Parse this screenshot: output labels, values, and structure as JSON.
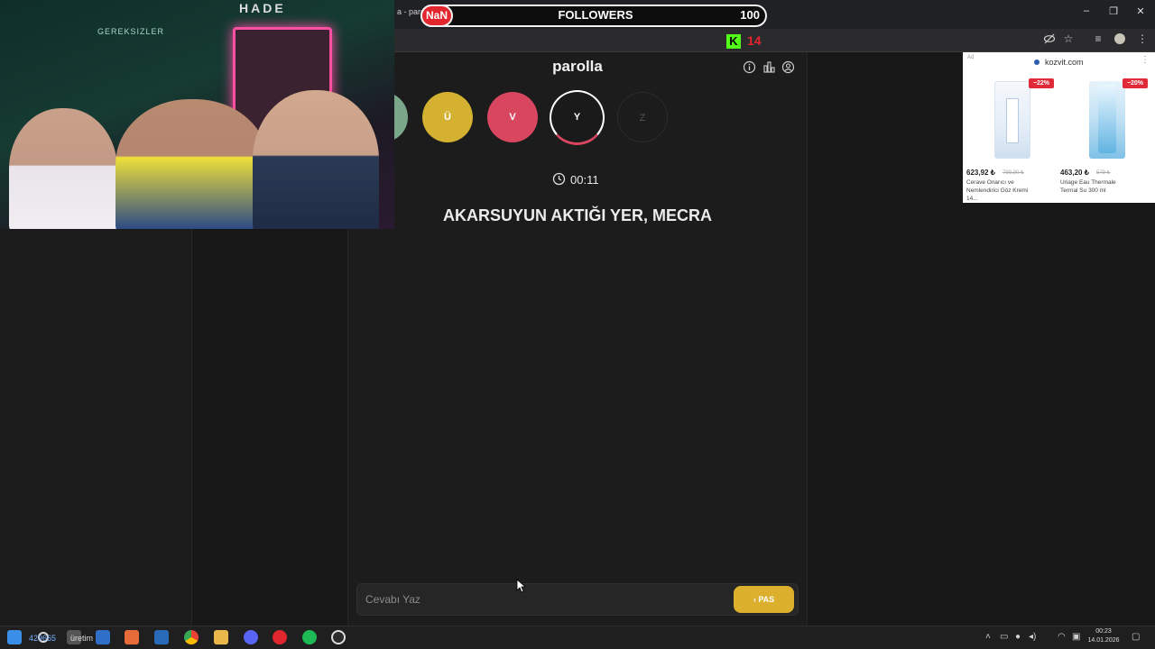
{
  "browser": {
    "tab_fragment": "a - paro",
    "new_tab_symbol": "+",
    "window_controls": [
      "–",
      "❐",
      "✕"
    ],
    "toolbar_icons": [
      "eye-off-icon",
      "star-icon",
      "media-icon",
      "profile-icon",
      "kebab-menu-icon"
    ]
  },
  "stream_overlay": {
    "nan_label": "NaN",
    "followers_label": "FOLLOWERS",
    "followers_count": "100",
    "kick_logo": "K",
    "kick_count": "14",
    "colors": {
      "red": "#e3262d",
      "kick_green": "#53fc18"
    }
  },
  "app": {
    "title": "parolla",
    "header_icons": [
      "info-icon",
      "stats-icon",
      "user-icon"
    ],
    "letters": [
      {
        "label": "",
        "state": "answered-green"
      },
      {
        "label": "Ü",
        "state": "passed-yellow"
      },
      {
        "label": "V",
        "state": "wrong-red"
      },
      {
        "label": "Y",
        "state": "current"
      },
      {
        "label": "Z",
        "state": "pending"
      }
    ],
    "timer": "00:11",
    "question": "AKARSUYUN AKTIĞI YER, MECRA",
    "answer_placeholder": "Cevabı Yaz",
    "pass_label": "PAS",
    "colors": {
      "green": "#7aa689",
      "yellow": "#d4b131",
      "red": "#d9465f"
    }
  },
  "ad": {
    "tag": "Ad",
    "domain": "kozvit.com",
    "products": [
      {
        "badge": "−22%",
        "price": "623,92 ₺",
        "old_price": "799,90 ₺",
        "name": "Cerave Onarıcı ve Nemlendirici Göz Kremi 14..."
      },
      {
        "badge": "−20%",
        "price": "463,20 ₺",
        "old_price": "579 ₺",
        "name": "Uriage Eau Thermale Termal Su 300 ml"
      }
    ]
  },
  "webcam": {
    "wall_text": "GEREKSIZLER",
    "top_text": "HADE"
  },
  "taskbar": {
    "overlay_numbers": "429665",
    "overlay_word": "üretim",
    "apps": [
      "windows-icon",
      "search-icon",
      "task-view-icon",
      "store-icon",
      "figma-icon",
      "calculator-icon",
      "chrome-icon",
      "files-icon",
      "discord-icon",
      "red-app-icon",
      "spotify-icon",
      "obs-icon"
    ],
    "time": "00:23",
    "date": "14.01.2026"
  }
}
